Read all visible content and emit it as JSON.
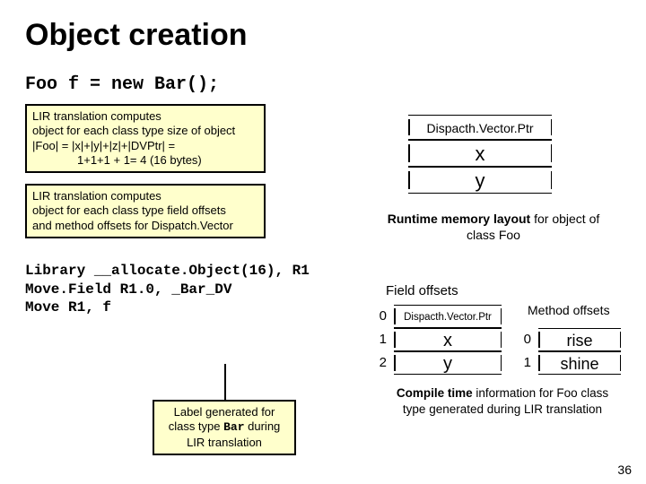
{
  "title": "Object creation",
  "code_stmt": "Foo f = new Bar();",
  "note1": {
    "l1": "LIR translation computes",
    "l2": "object for each class type size of object",
    "l3": "|Foo| = |x|+|y|+|z|+|DVPtr| =",
    "l4": "1+1+1 + 1= 4 (16 bytes)"
  },
  "note2": {
    "l1": "LIR translation computes",
    "l2": "object for each class type field offsets",
    "l3": "and method offsets for Dispatch.Vector"
  },
  "library": {
    "l1": "Library __allocate.Object(16), R1",
    "l2": "Move.Field R1.0, _Bar_DV",
    "l3": "Move R1, f"
  },
  "mem": {
    "r0": "Dispacth.Vector.Ptr",
    "r1": "x",
    "r2": "y"
  },
  "runtime_caption": {
    "b": "Runtime memory layout",
    "rest": " for object of class Foo"
  },
  "field_offsets_label": "Field offsets",
  "field_table": {
    "idx": [
      "0",
      "1",
      "2"
    ],
    "cells": [
      "Dispacth.Vector.Ptr",
      "x",
      "y"
    ]
  },
  "method_offsets_label": "Method offsets",
  "method_table": {
    "idx": [
      "0",
      "1"
    ],
    "cells": [
      "rise",
      "shine"
    ]
  },
  "compile_caption": {
    "b": "Compile time",
    "rest": " information for Foo class type generated during LIR translation"
  },
  "label_note": {
    "pre": "Label generated for class type ",
    "mono": "Bar",
    "post": " during LIR translation"
  },
  "page": "36"
}
